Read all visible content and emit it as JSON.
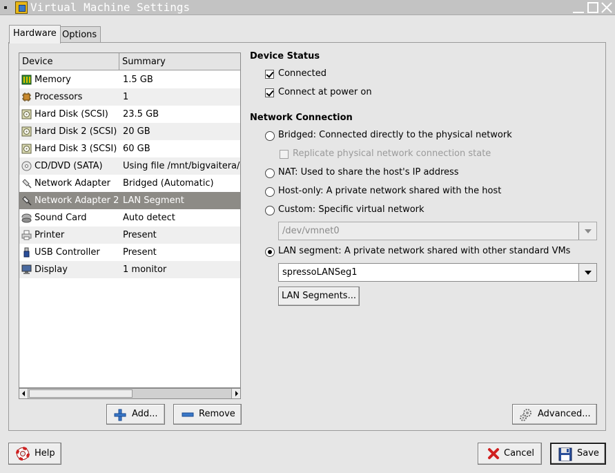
{
  "window": {
    "title": "Virtual Machine Settings"
  },
  "tabs": [
    {
      "label": "Hardware",
      "active": true
    },
    {
      "label": "Options",
      "active": false
    }
  ],
  "device_table": {
    "columns": [
      "Device",
      "Summary"
    ],
    "rows": [
      {
        "device": "Memory",
        "summary": "1.5 GB",
        "icon": "memory-icon"
      },
      {
        "device": "Processors",
        "summary": "1",
        "icon": "processor-icon"
      },
      {
        "device": "Hard Disk (SCSI)",
        "summary": "23.5 GB",
        "icon": "hard-disk-icon"
      },
      {
        "device": "Hard Disk 2 (SCSI)",
        "summary": "20 GB",
        "icon": "hard-disk-icon"
      },
      {
        "device": "Hard Disk 3 (SCSI)",
        "summary": "60 GB",
        "icon": "hard-disk-icon"
      },
      {
        "device": "CD/DVD (SATA)",
        "summary": "Using file /mnt/bigvaitera/d",
        "icon": "cd-dvd-icon"
      },
      {
        "device": "Network Adapter",
        "summary": "Bridged (Automatic)",
        "icon": "network-adapter-icon"
      },
      {
        "device": "Network Adapter 2",
        "summary": "LAN Segment",
        "icon": "network-adapter-icon",
        "selected": true
      },
      {
        "device": "Sound Card",
        "summary": "Auto detect",
        "icon": "sound-card-icon"
      },
      {
        "device": "Printer",
        "summary": "Present",
        "icon": "printer-icon"
      },
      {
        "device": "USB Controller",
        "summary": "Present",
        "icon": "usb-icon"
      },
      {
        "device": "Display",
        "summary": "1 monitor",
        "icon": "display-icon"
      }
    ]
  },
  "list_buttons": {
    "add": "Add...",
    "remove": "Remove"
  },
  "device_status": {
    "title": "Device Status",
    "connected": {
      "label": "Connected",
      "checked": true
    },
    "connect_at_power_on": {
      "label": "Connect at power on",
      "checked": true
    }
  },
  "network_connection": {
    "title": "Network Connection",
    "bridged": "Bridged: Connected directly to the physical network",
    "replicate": "Replicate physical network connection state",
    "nat": "NAT: Used to share the host's IP address",
    "host_only": "Host-only: A private network shared with the host",
    "custom": "Custom: Specific virtual network",
    "custom_value": "/dev/vmnet0",
    "lan_segment": "LAN segment: A private network shared with other standard VMs",
    "lan_segment_value": "spressoLANSeg1",
    "lan_segments_button": "LAN Segments...",
    "selected": "lan_segment"
  },
  "advanced_button": "Advanced...",
  "footer": {
    "help": "Help",
    "cancel": "Cancel",
    "save": "Save"
  }
}
